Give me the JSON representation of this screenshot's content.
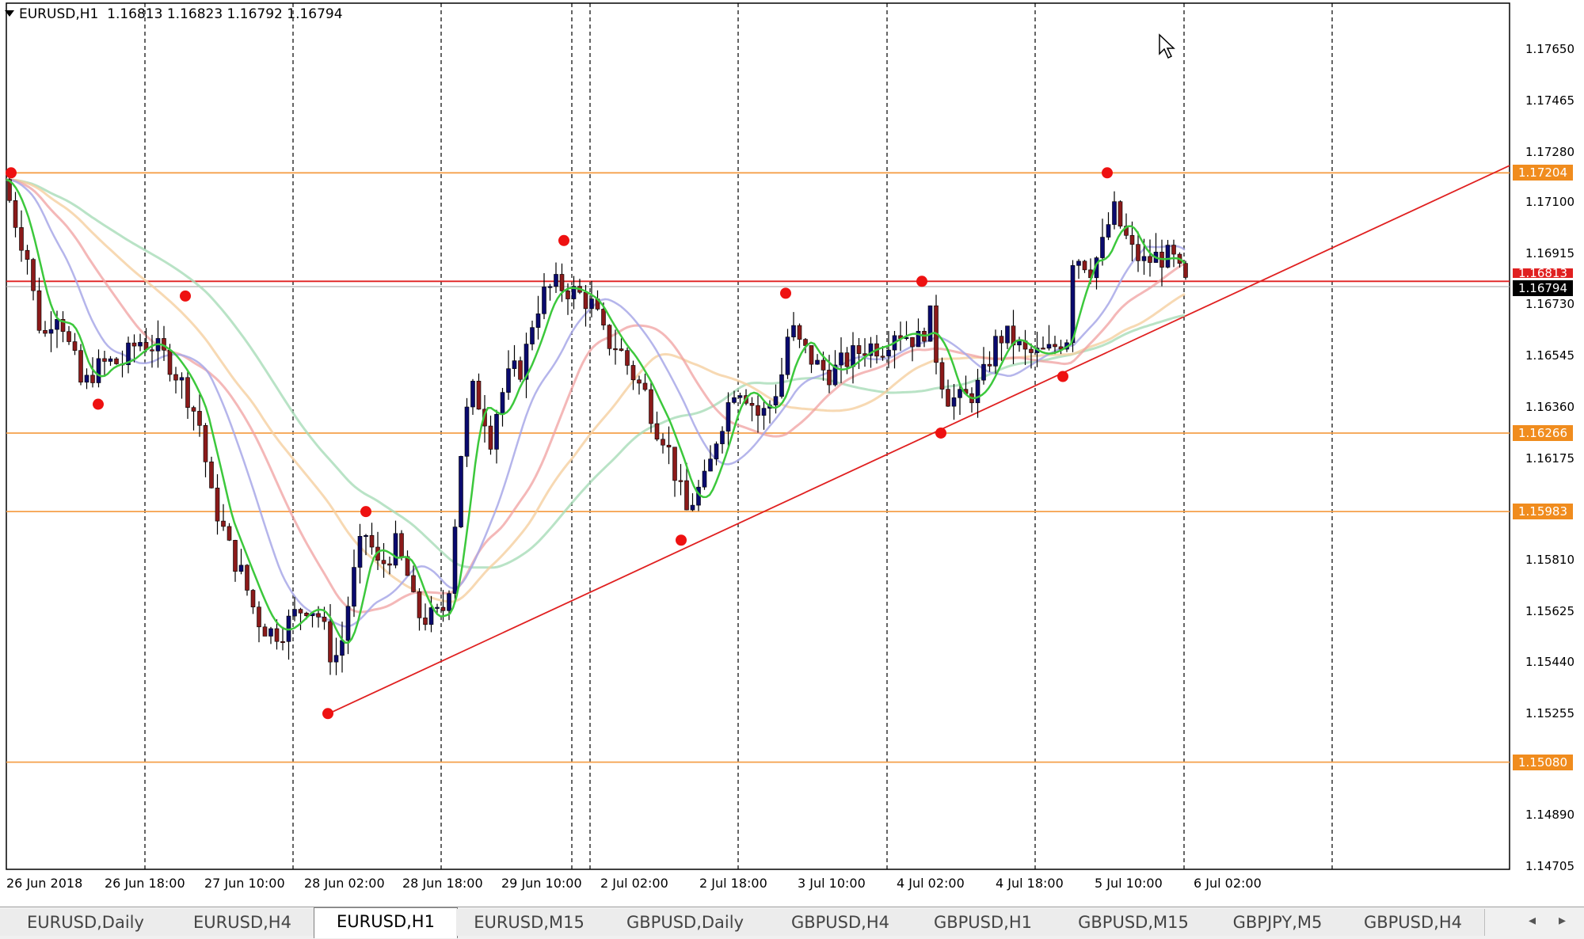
{
  "header": {
    "symbol": "EURUSD,H1",
    "ohlc": "1.16813 1.16823 1.16792 1.16794"
  },
  "price_axis": [
    "1.17650",
    "1.17465",
    "1.17280",
    "1.17100",
    "1.16915",
    "1.16730",
    "1.16545",
    "1.16360",
    "1.16175",
    "1.15810",
    "1.15625",
    "1.15440",
    "1.15255",
    "1.14890",
    "1.14705"
  ],
  "level_badges": [
    "1.17204",
    "1.16266",
    "1.15983",
    "1.15080"
  ],
  "bid_line_badge": "1.16813",
  "current_price_badge": "1.16794",
  "time_axis": [
    "26 Jun 2018",
    "26 Jun 18:00",
    "27 Jun 10:00",
    "28 Jun 02:00",
    "28 Jun 18:00",
    "29 Jun 10:00",
    "2 Jul 02:00",
    "2 Jul 18:00",
    "3 Jul 10:00",
    "4 Jul 02:00",
    "4 Jul 18:00",
    "5 Jul 10:00",
    "6 Jul 02:00"
  ],
  "tabs": [
    "EURUSD,Daily",
    "EURUSD,H4",
    "EURUSD,H1",
    "EURUSD,M15",
    "GBPUSD,Daily",
    "GBPUSD,H4",
    "GBPUSD,H1",
    "GBPUSD,M15",
    "GBPJPY,M5",
    "GBPUSD,H4"
  ],
  "active_tab": "EURUSD,H1",
  "colors": {
    "bull_candle": "#0a0a6e",
    "bear_candle": "#8b1a1a",
    "horizontal_level": "#f5a04a",
    "trendline": "#e02020",
    "bid_line": "#e02020",
    "ma_fast": "#3cc83c",
    "ma_mid": "#a8a8e8",
    "ma_slow1": "#f0a0a0",
    "ma_slow2": "#f5cfa0",
    "ma_slow3": "#a8dcb8",
    "fractal_marker": "#ee1111",
    "badge_orange": "#f08c1e"
  },
  "chart_data": {
    "type": "candlestick",
    "y_range": [
      1.14705,
      1.1765
    ],
    "horizontal_levels": [
      1.17204,
      1.16266,
      1.15983,
      1.1508
    ],
    "trendline": {
      "from": [
        "28 Jun 02:00",
        1.15255
      ],
      "to": [
        "6 Jul 02:00+",
        1.17204
      ]
    },
    "price_points": [
      [
        0,
        1.1718
      ],
      [
        8,
        1.171
      ],
      [
        18,
        1.17
      ],
      [
        30,
        1.169
      ],
      [
        40,
        1.1672
      ],
      [
        50,
        1.166
      ],
      [
        60,
        1.1668
      ],
      [
        70,
        1.1672
      ],
      [
        80,
        1.166
      ],
      [
        90,
        1.1652
      ],
      [
        100,
        1.1642
      ],
      [
        110,
        1.1648
      ],
      [
        130,
        1.1652
      ],
      [
        150,
        1.1652
      ],
      [
        170,
        1.166
      ],
      [
        190,
        1.1658
      ],
      [
        210,
        1.1652
      ],
      [
        230,
        1.1642
      ],
      [
        250,
        1.1628
      ],
      [
        260,
        1.1605
      ],
      [
        270,
        1.1598
      ],
      [
        285,
        1.1585
      ],
      [
        300,
        1.1576
      ],
      [
        310,
        1.1568
      ],
      [
        320,
        1.156
      ],
      [
        335,
        1.1555
      ],
      [
        350,
        1.1555
      ],
      [
        370,
        1.1562
      ],
      [
        385,
        1.1565
      ],
      [
        400,
        1.156
      ],
      [
        415,
        1.1545
      ],
      [
        425,
        1.1548
      ],
      [
        438,
        1.157
      ],
      [
        450,
        1.1585
      ],
      [
        460,
        1.1592
      ],
      [
        470,
        1.1578
      ],
      [
        480,
        1.158
      ],
      [
        495,
        1.1586
      ],
      [
        510,
        1.1575
      ],
      [
        520,
        1.1562
      ],
      [
        530,
        1.156
      ],
      [
        545,
        1.156
      ],
      [
        560,
        1.1565
      ],
      [
        570,
        1.1595
      ],
      [
        580,
        1.1628
      ],
      [
        592,
        1.1642
      ],
      [
        605,
        1.1635
      ],
      [
        615,
        1.1625
      ],
      [
        625,
        1.1638
      ],
      [
        640,
        1.1648
      ],
      [
        655,
        1.165
      ],
      [
        670,
        1.167
      ],
      [
        685,
        1.1678
      ],
      [
        700,
        1.168
      ],
      [
        715,
        1.1678
      ],
      [
        730,
        1.1676
      ],
      [
        745,
        1.1672
      ],
      [
        760,
        1.166
      ],
      [
        775,
        1.1658
      ],
      [
        790,
        1.165
      ],
      [
        800,
        1.1645
      ],
      [
        812,
        1.164
      ],
      [
        822,
        1.163
      ],
      [
        835,
        1.1625
      ],
      [
        850,
        1.161
      ],
      [
        862,
        1.1598
      ],
      [
        875,
        1.1605
      ],
      [
        888,
        1.161
      ],
      [
        900,
        1.1625
      ],
      [
        912,
        1.1635
      ],
      [
        925,
        1.1645
      ],
      [
        940,
        1.164
      ],
      [
        955,
        1.1632
      ],
      [
        970,
        1.1638
      ],
      [
        985,
        1.165
      ],
      [
        993,
        1.1668
      ],
      [
        1000,
        1.166
      ],
      [
        1015,
        1.1655
      ],
      [
        1030,
        1.165
      ],
      [
        1045,
        1.1648
      ],
      [
        1060,
        1.1652
      ],
      [
        1075,
        1.1655
      ],
      [
        1090,
        1.1658
      ],
      [
        1110,
        1.1658
      ],
      [
        1125,
        1.1664
      ],
      [
        1140,
        1.1662
      ],
      [
        1155,
        1.166
      ],
      [
        1170,
        1.1668
      ],
      [
        1180,
        1.165
      ],
      [
        1192,
        1.164
      ],
      [
        1205,
        1.1638
      ],
      [
        1220,
        1.164
      ],
      [
        1235,
        1.1645
      ],
      [
        1250,
        1.1658
      ],
      [
        1262,
        1.1662
      ],
      [
        1275,
        1.166
      ],
      [
        1290,
        1.1655
      ],
      [
        1305,
        1.1655
      ],
      [
        1320,
        1.1656
      ],
      [
        1335,
        1.166
      ],
      [
        1345,
        1.1662
      ],
      [
        1350,
        1.169
      ],
      [
        1360,
        1.169
      ],
      [
        1372,
        1.1686
      ],
      [
        1385,
        1.1692
      ],
      [
        1392,
        1.1698
      ],
      [
        1400,
        1.1708
      ],
      [
        1412,
        1.17
      ],
      [
        1425,
        1.1692
      ],
      [
        1440,
        1.1688
      ],
      [
        1455,
        1.169
      ],
      [
        1470,
        1.169
      ],
      [
        1480,
        1.1688
      ],
      [
        1490,
        1.168
      ]
    ],
    "fractals": [
      {
        "x": 14,
        "price": 1.17204,
        "pos": "top"
      },
      {
        "x": 124,
        "price": 1.1637,
        "pos": "bottom"
      },
      {
        "x": 234,
        "price": 1.1676,
        "pos": "top"
      },
      {
        "x": 414,
        "price": 1.15255,
        "pos": "bottom"
      },
      {
        "x": 462,
        "price": 1.15983,
        "pos": "top"
      },
      {
        "x": 712,
        "price": 1.1696,
        "pos": "top"
      },
      {
        "x": 860,
        "price": 1.1588,
        "pos": "bottom"
      },
      {
        "x": 992,
        "price": 1.1677,
        "pos": "top"
      },
      {
        "x": 1164,
        "price": 1.16813,
        "pos": "top"
      },
      {
        "x": 1188,
        "price": 1.16266,
        "pos": "bottom"
      },
      {
        "x": 1342,
        "price": 1.1647,
        "pos": "bottom"
      },
      {
        "x": 1398,
        "price": 1.17204,
        "pos": "top"
      }
    ]
  }
}
